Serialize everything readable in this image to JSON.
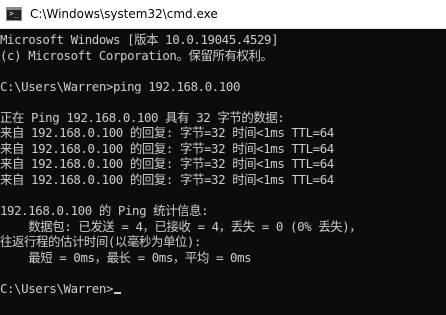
{
  "window": {
    "title": "C:\\Windows\\system32\\cmd.exe",
    "icon": "cmd-terminal-icon"
  },
  "console": {
    "lines": [
      "Microsoft Windows [版本 10.0.19045.4529]",
      "(c) Microsoft Corporation。保留所有权利。",
      "",
      "C:\\Users\\Warren>ping 192.168.0.100",
      "",
      "正在 Ping 192.168.0.100 具有 32 字节的数据:",
      "来自 192.168.0.100 的回复: 字节=32 时间<1ms TTL=64",
      "来自 192.168.0.100 的回复: 字节=32 时间<1ms TTL=64",
      "来自 192.168.0.100 的回复: 字节=32 时间<1ms TTL=64",
      "来自 192.168.0.100 的回复: 字节=32 时间<1ms TTL=64",
      "",
      "192.168.0.100 的 Ping 统计信息:",
      "    数据包: 已发送 = 4，已接收 = 4，丢失 = 0 (0% 丢失)，",
      "往返行程的估计时间(以毫秒为单位):",
      "    最短 = 0ms，最长 = 0ms，平均 = 0ms",
      ""
    ],
    "prompt": "C:\\Users\\Warren>",
    "foreground": "#cccccc",
    "background": "#0c0c0c"
  }
}
